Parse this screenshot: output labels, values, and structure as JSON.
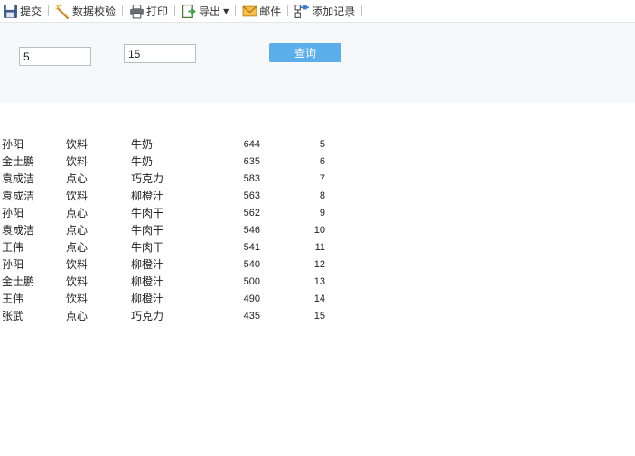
{
  "toolbar": {
    "submit": "提交",
    "validate": "数据校验",
    "print": "打印",
    "export": "导出",
    "mail": "邮件",
    "add_record": "添加记录"
  },
  "params": {
    "param1_value": "5",
    "param2_value": "15",
    "query_label": "查询"
  },
  "colors": {
    "query_button": "#5aaeea",
    "panel_bg": "#f7f8fa"
  },
  "report": {
    "rows": [
      {
        "name": "孙阳",
        "category": "饮料",
        "product": "牛奶",
        "amount": "644",
        "rank": "5"
      },
      {
        "name": "金士鹏",
        "category": "饮料",
        "product": "牛奶",
        "amount": "635",
        "rank": "6"
      },
      {
        "name": "袁成洁",
        "category": "点心",
        "product": "巧克力",
        "amount": "583",
        "rank": "7"
      },
      {
        "name": "袁成洁",
        "category": "饮料",
        "product": "柳橙汁",
        "amount": "563",
        "rank": "8"
      },
      {
        "name": "孙阳",
        "category": "点心",
        "product": "牛肉干",
        "amount": "562",
        "rank": "9"
      },
      {
        "name": "袁成洁",
        "category": "点心",
        "product": "牛肉干",
        "amount": "546",
        "rank": "10"
      },
      {
        "name": "王伟",
        "category": "点心",
        "product": "牛肉干",
        "amount": "541",
        "rank": "11"
      },
      {
        "name": "孙阳",
        "category": "饮料",
        "product": "柳橙汁",
        "amount": "540",
        "rank": "12"
      },
      {
        "name": "金士鹏",
        "category": "饮料",
        "product": "柳橙汁",
        "amount": "500",
        "rank": "13"
      },
      {
        "name": "王伟",
        "category": "饮料",
        "product": "柳橙汁",
        "amount": "490",
        "rank": "14"
      },
      {
        "name": "张武",
        "category": "点心",
        "product": "巧克力",
        "amount": "435",
        "rank": "15"
      }
    ]
  }
}
